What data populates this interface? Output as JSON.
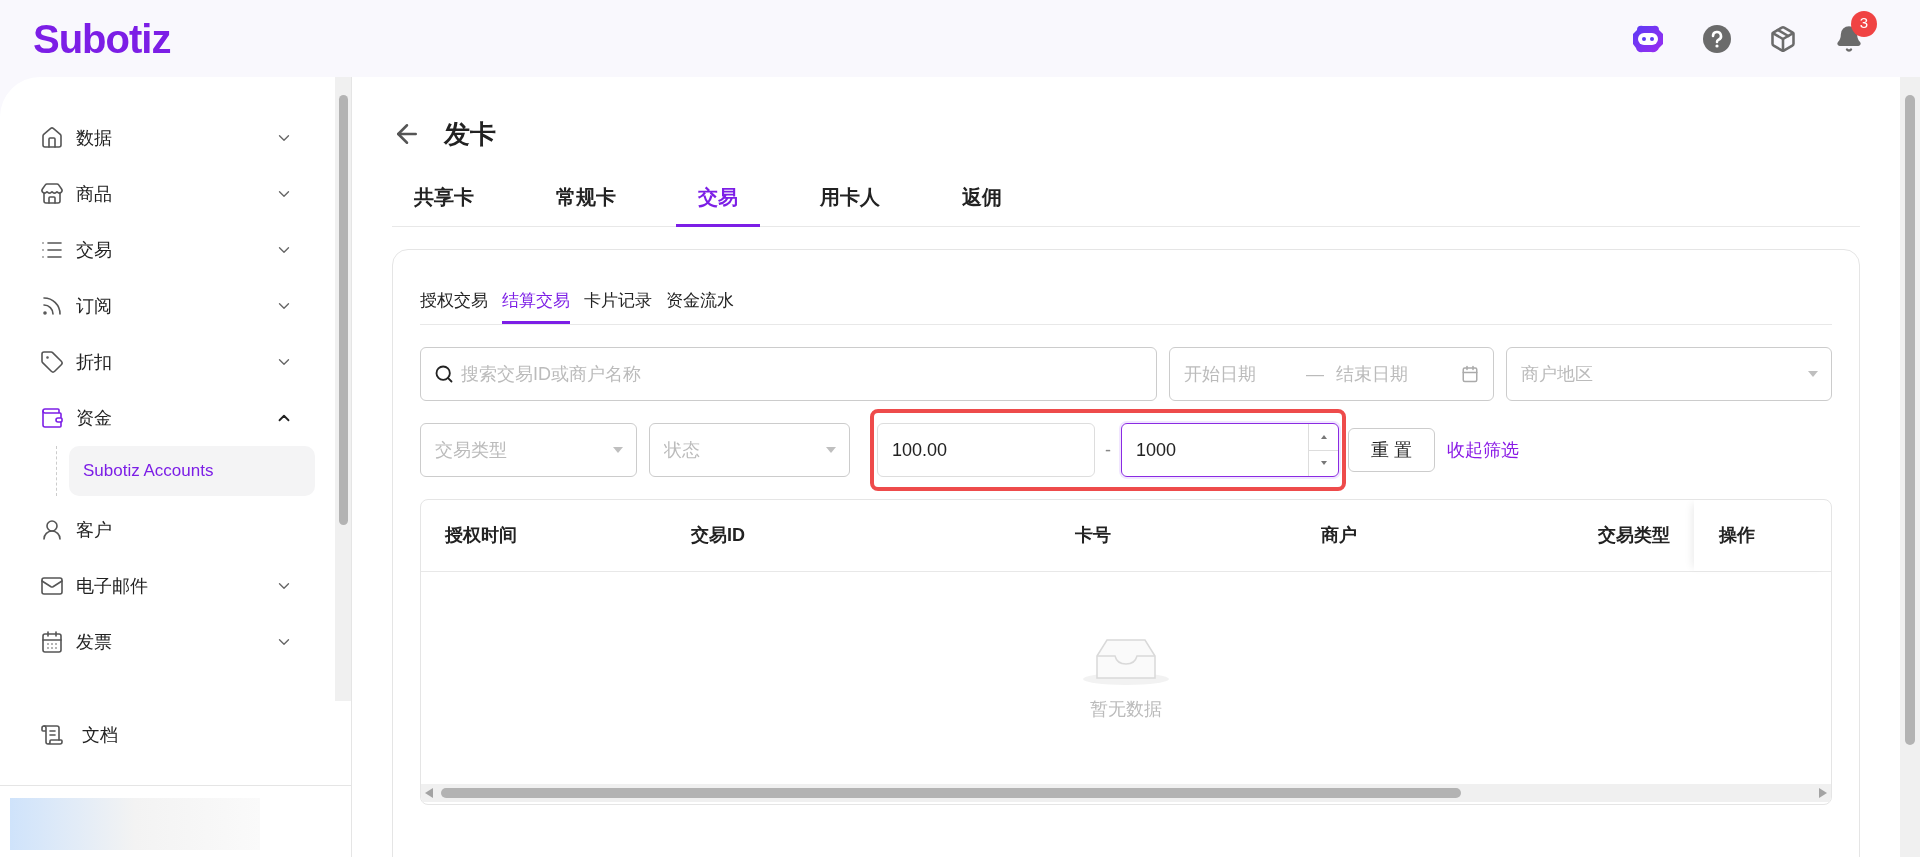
{
  "header": {
    "logo": "Subotiz",
    "notification_count": "3"
  },
  "sidebar": {
    "items": [
      {
        "label": "数据",
        "kind": "group",
        "expanded": false
      },
      {
        "label": "商品",
        "kind": "group",
        "expanded": false
      },
      {
        "label": "交易",
        "kind": "group",
        "expanded": false
      },
      {
        "label": "订阅",
        "kind": "group",
        "expanded": false
      },
      {
        "label": "折扣",
        "kind": "group",
        "expanded": false
      },
      {
        "label": "资金",
        "kind": "group",
        "expanded": true,
        "children": [
          {
            "label": "Subotiz Accounts",
            "selected": true
          }
        ]
      },
      {
        "label": "客户",
        "kind": "link"
      },
      {
        "label": "电子邮件",
        "kind": "group",
        "expanded": false
      },
      {
        "label": "发票",
        "kind": "group",
        "expanded": false
      }
    ],
    "footer_item": {
      "label": "文档"
    }
  },
  "page": {
    "title": "发卡",
    "tabs": [
      {
        "label": "共享卡",
        "selected": false
      },
      {
        "label": "常规卡",
        "selected": false
      },
      {
        "label": "交易",
        "selected": true
      },
      {
        "label": "用卡人",
        "selected": false
      },
      {
        "label": "返佣",
        "selected": false
      }
    ],
    "sub_tabs": [
      {
        "label": "授权交易",
        "selected": false
      },
      {
        "label": "结算交易",
        "selected": true
      },
      {
        "label": "卡片记录",
        "selected": false
      },
      {
        "label": "资金流水",
        "selected": false
      }
    ],
    "filters": {
      "search": {
        "placeholder": "搜索交易ID或商户名称"
      },
      "date_range": {
        "start_placeholder": "开始日期",
        "separator": "—",
        "end_placeholder": "结束日期"
      },
      "region": {
        "placeholder": "商户地区"
      },
      "type": {
        "placeholder": "交易类型"
      },
      "status": {
        "placeholder": "状态"
      },
      "amount_min": {
        "value": "100.00",
        "focused": false
      },
      "amount_separator": "-",
      "amount_max": {
        "value": "1000",
        "focused": true
      },
      "reset_button": "重 置",
      "collapse_link": "收起筛选"
    },
    "table": {
      "columns": [
        "授权时间",
        "交易ID",
        "卡号",
        "商户",
        "交易类型",
        "操作"
      ],
      "empty_text": "暂无数据"
    }
  }
}
